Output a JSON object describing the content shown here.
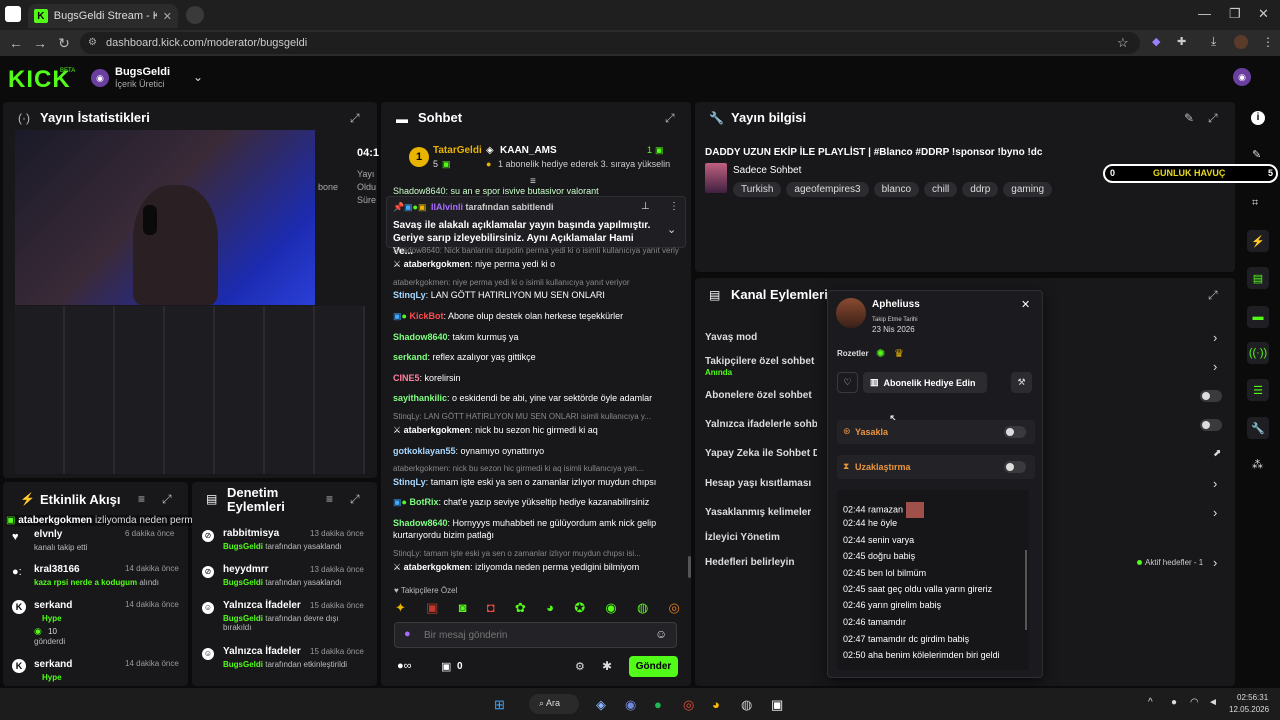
{
  "browser": {
    "tab_title": "BugsGeldi Stream - Kick Dashb",
    "url": "dashboard.kick.com/moderator/bugsgeldi"
  },
  "header": {
    "logo": "KICK",
    "beta": "BETA",
    "channel_name": "BugsGeldi",
    "channel_role": "İçerik Üretici"
  },
  "stats": {
    "title": "Yayın İstatistikleri",
    "time_partial": "04:1",
    "text_partial_1": "bone",
    "text_partial_2": "Yayı",
    "text_partial_3": "Oldu",
    "text_partial_4": "Süre"
  },
  "activity": {
    "title": "Etkinlik Akışı",
    "overlay_user": "ataberkgokmen",
    "overlay_msg": "izliyomda neden perma yedigini bilmiyom",
    "items": [
      {
        "user": "elvnly",
        "time": "6 dakika önce",
        "detail": "kanalı takip etti"
      },
      {
        "user": "kral38166",
        "time": "14 dakika önce",
        "detail": "kaza rpsi nerde a kodugum",
        "detail2": "alındı"
      },
      {
        "user": "serkand",
        "time": "14 dakika önce",
        "detail": "Hype",
        "amount": "10",
        "detail2": "gönderdi"
      },
      {
        "user": "serkand",
        "time": "14 dakika önce",
        "detail": "Hype"
      }
    ]
  },
  "audit": {
    "title": "Denetim Eylemleri",
    "items": [
      {
        "title": "rabbitmisya",
        "time": "13 dakika önce",
        "actor": "BugsGeldi",
        "action": "tarafından yasaklandı"
      },
      {
        "title": "heyydmrr",
        "time": "13 dakika önce",
        "actor": "BugsGeldi",
        "action": "tarafından yasaklandı"
      },
      {
        "title": "Yalnızca İfadeler",
        "time": "15 dakika önce",
        "actor": "BugsGeldi",
        "action": "tarafından devre dışı bırakıldı"
      },
      {
        "title": "Yalnızca İfadeler",
        "time": "15 dakika önce",
        "actor": "BugsGeldi",
        "action": "tarafından etkinleştirildi"
      }
    ]
  },
  "chat": {
    "title": "Sohbet",
    "top_user": "TatarGeldi",
    "top_count": "5",
    "top_gifter": "KAAN_AMS",
    "top_gifter_count": "1",
    "gift_msg": "1 abonelik hediye ederek 3. sıraya yükselin",
    "pinned_by": "IlAlvinli",
    "pinned_label": "tarafından sabitlendi",
    "pinned_text": "Savaş ile alakalı açıklamalar yayın başında yapılmıştır. Geriye sarıp izleyebilirsiniz. Aynı Açıklamalar Hami Ve...",
    "hidden_line": "Shadow8640: su an e spor isvive butasivor valorant",
    "messages": [
      {
        "reply": "Shadow8640: Nick banlarını durpolin perma yedi ki o isimli kullanıcıya yanıt veriy"
      },
      {
        "user": "ataberkgokmen",
        "color": "#ffffff",
        "text": "niye perma yedi ki o"
      },
      {
        "reply": "ataberkgokmen: niye perma yedi ki o isimli kullanıcıya yanıt veriyor"
      },
      {
        "user": "StinqLy",
        "color": "#a8d8ff",
        "text": "LAN GÖTT HATIRLIYON MU SEN ONLARI"
      },
      {
        "user": "KickBot",
        "color": "#ff4d4d",
        "text": "Abone olup destek olan herkese teşekkürler"
      },
      {
        "user": "Shadow8640",
        "color": "#7fff7f",
        "text": "takım kurmuş ya"
      },
      {
        "user": "serkand",
        "color": "#7fff7f",
        "text": "reflex azalıyor yaş gittikçe"
      },
      {
        "user": "CINE5",
        "color": "#ff7f9f",
        "text": "korelirsin"
      },
      {
        "user": "sayithankilic",
        "color": "#7fff7f",
        "text": "o eskidendi be abi, yine var sektörde öyle adamlar"
      },
      {
        "reply": "StinqLy: LAN GÖTT HATIRLIYON MU SEN ONLARI isimli kullanıcıya y..."
      },
      {
        "user": "ataberkgokmen",
        "color": "#ffffff",
        "text": "nick bu sezon hic girmedi ki aq"
      },
      {
        "user": "gotkoklayan55",
        "color": "#a8d8ff",
        "text": "oynamıyo oynattırıyo"
      },
      {
        "reply": "ataberkgokmen: nick bu sezon hic girmedi ki aq isimli kullanıcıya yan..."
      },
      {
        "user": "StinqLy",
        "color": "#a8d8ff",
        "text": "tamam işte eski ya sen o zamanlar izlıyor muydun chıpsı"
      },
      {
        "user": "BotRix",
        "color": "#7fff7f",
        "text": "chat'e yazıp seviye yükseltip hediye kazanabilirsiniz"
      },
      {
        "user": "Shadow8640",
        "color": "#7fff7f",
        "text": "Hornyyys muhabbeti ne gülüyordum amk nick gelip kurtarıyordu bizim patlağı"
      },
      {
        "reply": "StinqLy: tamam işte eski ya sen o zamanlar izlıyor muydun chıpsı isi..."
      },
      {
        "user": "ataberkgokmen",
        "color": "#ffffff",
        "text": "izliyomda neden perma yedigini bilmiyom"
      }
    ],
    "emote_label": "Takipçilere Özel",
    "input_placeholder": "Bir mesaj gönderin",
    "points": "0",
    "send_label": "Gönder"
  },
  "stream_info": {
    "title": "Yayın bilgisi",
    "stream_title": "DADDY UZUN EKİP İLE PLAYLİST | #Blanco #DDRP !sponsor !byno !dc",
    "category": "Sadece Sohbet",
    "tags": [
      "Turkish",
      "ageofempires3",
      "blanco",
      "chill",
      "ddrp",
      "gaming"
    ],
    "havuc_left": "0",
    "havuc_label": "GUNLUK HAVUÇ",
    "havuc_right": "5"
  },
  "channel_actions": {
    "title": "Kanal Eylemleri",
    "rows": [
      {
        "label": "Yavaş mod"
      },
      {
        "label": "Takipçilere özel sohbet",
        "sub": "Anında"
      },
      {
        "label": "Abonelere özel sohbet"
      },
      {
        "label": "Yalnızca ifadelerle sohbet"
      },
      {
        "label": "Yapay Zeka ile Sohbet De"
      },
      {
        "label": "Hesap yaşı kısıtlaması"
      },
      {
        "label": "Yasaklanmış kelimeler"
      },
      {
        "label": "İzleyici Yönetim"
      },
      {
        "label": "Hedefleri belirleyin"
      }
    ],
    "goal_status": "Aktif hedefler - 1"
  },
  "user_card": {
    "name": "Apheliuss",
    "follow_label": "Takip Etme Tarihi",
    "follow_date": "23 Nis 2026",
    "badges_label": "Rozetler",
    "gift_label": "Abonelik Hediye Edin",
    "ban_label": "Yasakla",
    "timeout_label": "Uzaklaştırma",
    "history": [
      {
        "time": "02:44",
        "text": "ramazan"
      },
      {
        "time": "02:44",
        "text": "he öyle"
      },
      {
        "time": "02:44",
        "text": "senin varya"
      },
      {
        "time": "02:45",
        "text": "doğru babiş"
      },
      {
        "time": "02:45",
        "text": "ben lol bilmüm"
      },
      {
        "time": "02:45",
        "text": "saat geç oldu valla yarın gireriz"
      },
      {
        "time": "02:46",
        "text": "yarın girelim babiş"
      },
      {
        "time": "02:46",
        "text": "tamamdır"
      },
      {
        "time": "02:47",
        "text": "tamamdır dc girdim babiş"
      },
      {
        "time": "02:50",
        "text": "aha benim kölelerimden biri geldi"
      }
    ]
  },
  "taskbar": {
    "search": "Ara",
    "time": "02:56:31",
    "date": "12.05.2026"
  }
}
